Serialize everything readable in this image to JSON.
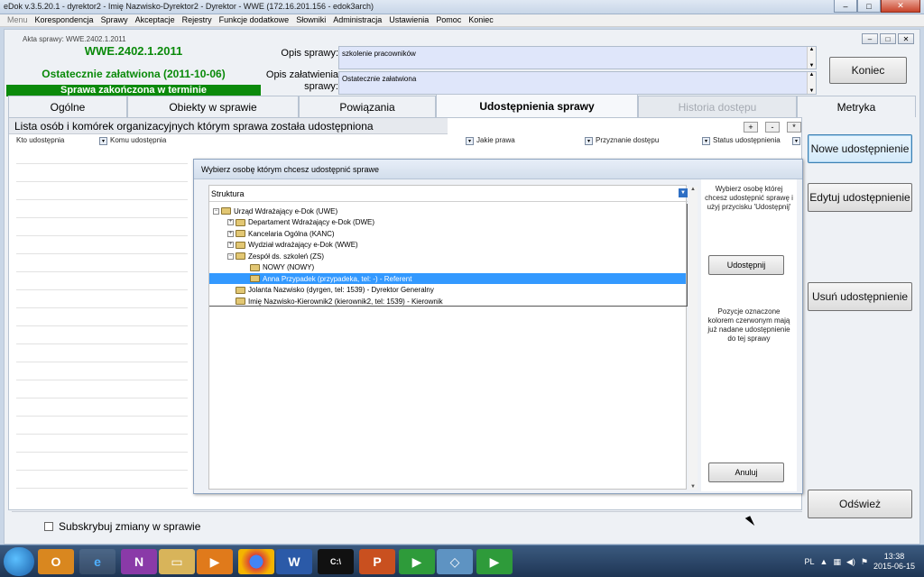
{
  "window": {
    "title": "eDok v.3.5.20.1 - dyrektor2 - Imię Nazwisko-Dyrektor2 - Dyrektor - WWE   (172.16.201.156 - edok3arch)",
    "btn_min": "–",
    "btn_max": "□",
    "btn_close": "✕"
  },
  "menu": {
    "items": [
      "Menu",
      "Korespondencja",
      "Sprawy",
      "Akceptacje",
      "Rejestry",
      "Funkcje dodatkowe",
      "Słowniki",
      "Administracja",
      "Ustawienia",
      "Pomoc",
      "Koniec"
    ]
  },
  "case": {
    "caption": "Akta sprawy: WWE.2402.1.2011",
    "number": "WWE.2402.1.2011",
    "status": "Ostatecznie załatwiona (2011-10-06)",
    "bar": "Sprawa zakończona w terminie",
    "opis_label": "Opis sprawy:",
    "opis_value": "szkolenie pracowników",
    "opis_zal_label": "Opis załatwienia sprawy:",
    "opis_zal_value": "Ostatecznie załatwiona",
    "mini_min": "–",
    "mini_max": "□",
    "mini_close": "✕"
  },
  "buttons": {
    "koniec": "Koniec",
    "nowe": "Nowe udostępnienie",
    "edytuj": "Edytuj udostępnienie",
    "usun": "Usuń udostępnienie",
    "odswiez": "Odśwież"
  },
  "tabs": [
    "Ogólne",
    "Obiekty w sprawie",
    "Powiązania",
    "Udostępnienia sprawy",
    "Historia dostępu",
    "Metryka"
  ],
  "list": {
    "title": "Lista osób i komórek organizacyjnych którym sprawa została udostępniona",
    "plus": "+",
    "minus": "-",
    "star": "*",
    "columns": [
      "Kto udostępnia",
      "Komu udostępnia",
      "Jakie prawa",
      "Przyznanie dostępu",
      "Status udostępnienia"
    ],
    "subscribe": "Subskrybuj zmiany w sprawie"
  },
  "dialog": {
    "title": "Wybierz osobę którym chcesz udostępnić sprawe",
    "tree_header": "Struktura",
    "tree": [
      {
        "label": "Urząd Wdrażający e-Dok  (UWE)",
        "level": 0,
        "exp": "−",
        "selected": false
      },
      {
        "label": "Departament Wdrażający e-Dok (DWE)",
        "level": 1,
        "exp": "+",
        "selected": false
      },
      {
        "label": "Kancelaria Ogólna (KANC)",
        "level": 1,
        "exp": "+",
        "selected": false
      },
      {
        "label": "Wydział wdrażający e-Dok (WWE)",
        "level": 1,
        "exp": "+",
        "selected": false
      },
      {
        "label": "Zespół  ds. szkoleń (ZS)",
        "level": 1,
        "exp": "−",
        "selected": false
      },
      {
        "label": "NOWY (NOWY)",
        "level": 2,
        "exp": "",
        "selected": false
      },
      {
        "label": "Anna Przypadek (przypadeka, tel: -) - Referent",
        "level": 2,
        "exp": "",
        "selected": true
      },
      {
        "label": "Jolanta Nazwisko (dyrgen, tel: 1539) - Dyrektor Generalny",
        "level": 1,
        "exp": "",
        "selected": false
      },
      {
        "label": "Imię Nazwisko-Kierownik2 (kierownik2, tel: 1539) - Kierownik",
        "level": 1,
        "exp": "",
        "selected": false
      }
    ],
    "help_top": "Wybierz osobę której chcesz udostępnić sprawę i użyj przycisku 'Udostępnij'",
    "btn_share": "Udostępnij",
    "help_bottom": "Pozycje oznaczone kolorem czerwonym mają już nadane udostępnienie do tej sprawy",
    "btn_cancel": "Anuluj"
  },
  "taskbar": {
    "lang": "PL",
    "time": "13:38",
    "date": "2015-06-15",
    "apps": [
      "outlook-icon",
      "ie-icon",
      "onenote-icon",
      "explorer-icon",
      "media-icon",
      "chrome-icon",
      "word-icon",
      "terminal-icon",
      "powerpoint-icon",
      "edok-icon",
      "paint-icon",
      "edok-icon-2"
    ]
  }
}
